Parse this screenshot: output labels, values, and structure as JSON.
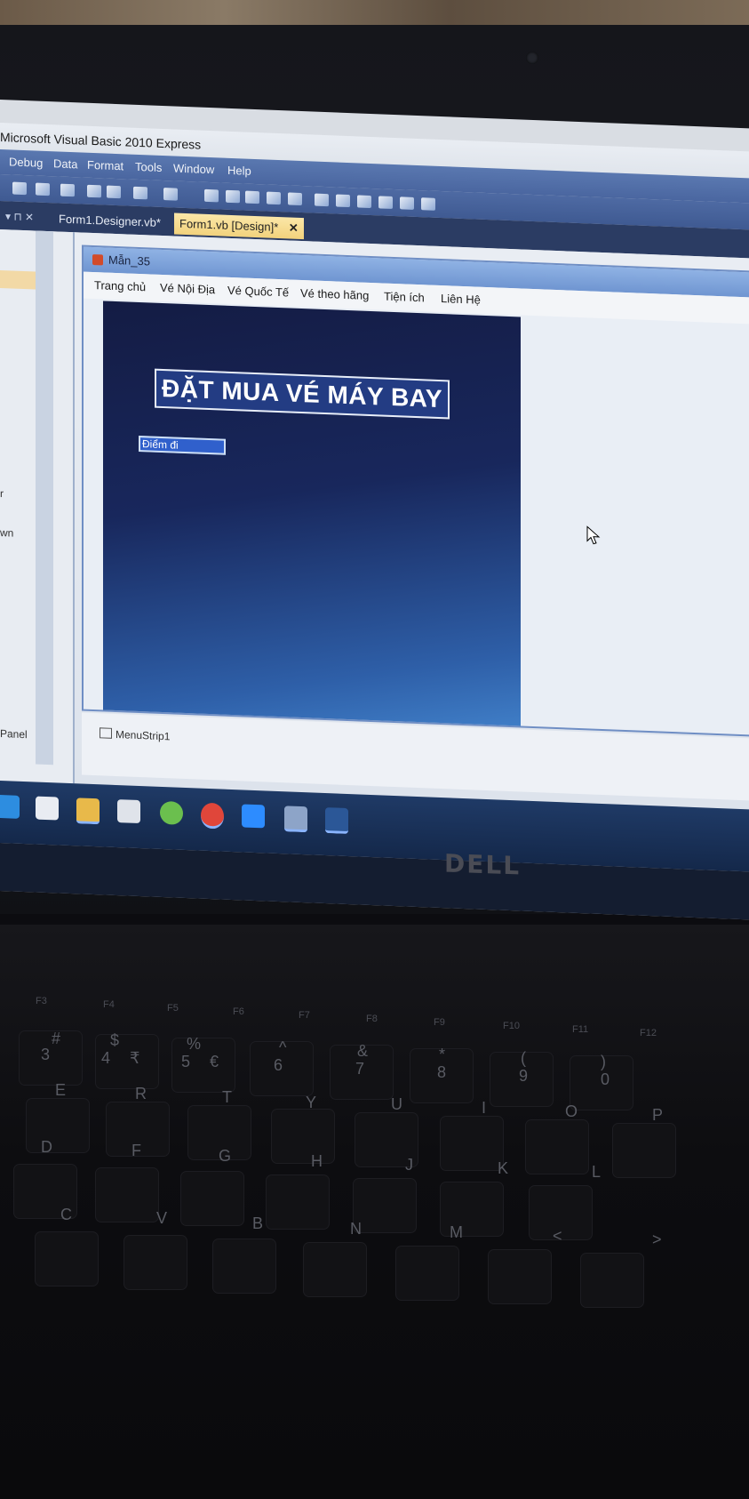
{
  "ide": {
    "title": "Microsoft Visual Basic 2010 Express",
    "menu": [
      "Debug",
      "Data",
      "Format",
      "Tools",
      "Window",
      "Help"
    ],
    "tabs": [
      {
        "label": "Form1.Designer.vb*",
        "active": false
      },
      {
        "label": "Form1.vb [Design]*",
        "active": true,
        "close": "✕"
      }
    ],
    "left_panel": [
      "r",
      "wn",
      "Panel"
    ]
  },
  "form": {
    "title": "Mẫn_35",
    "menu": [
      "Trang chủ",
      "Vé Nội Địa",
      "Vé Quốc Tế",
      "Vé theo hãng",
      "Tiện ích",
      "Liên Hệ"
    ],
    "heading": "ĐẶT MUA VÉ MÁY BAY",
    "field_label": "Điểm đi",
    "component_tray": "MenuStrip1"
  },
  "laptop": {
    "brand": "DELL"
  },
  "keyboard": {
    "fn_row": [
      "F3",
      "F4",
      "F5",
      "F6",
      "F7",
      "F8",
      "F9",
      "F10",
      "F11",
      "F12"
    ],
    "num_row": [
      "3",
      "4",
      "5",
      "6",
      "7",
      "8",
      "9",
      "0"
    ],
    "num_row_shift": [
      "#",
      "$",
      "%",
      "^",
      "&",
      "*",
      "(",
      ")"
    ],
    "extra_symbols": [
      "₹",
      "€"
    ],
    "row_top": [
      "E",
      "R",
      "T",
      "Y",
      "U",
      "I",
      "O",
      "P"
    ],
    "row_mid": [
      "D",
      "F",
      "G",
      "H",
      "J",
      "K",
      "L"
    ],
    "row_bottom": [
      "C",
      "V",
      "B",
      "N",
      "M",
      "<",
      ">"
    ]
  },
  "colors": {
    "form_bg_top": "#141c44",
    "form_bg_bottom": "#3f7dc6",
    "heading_bg": "#233c83",
    "tab_active": "#f2d27c",
    "ide_menubar": "#4a66a0"
  }
}
